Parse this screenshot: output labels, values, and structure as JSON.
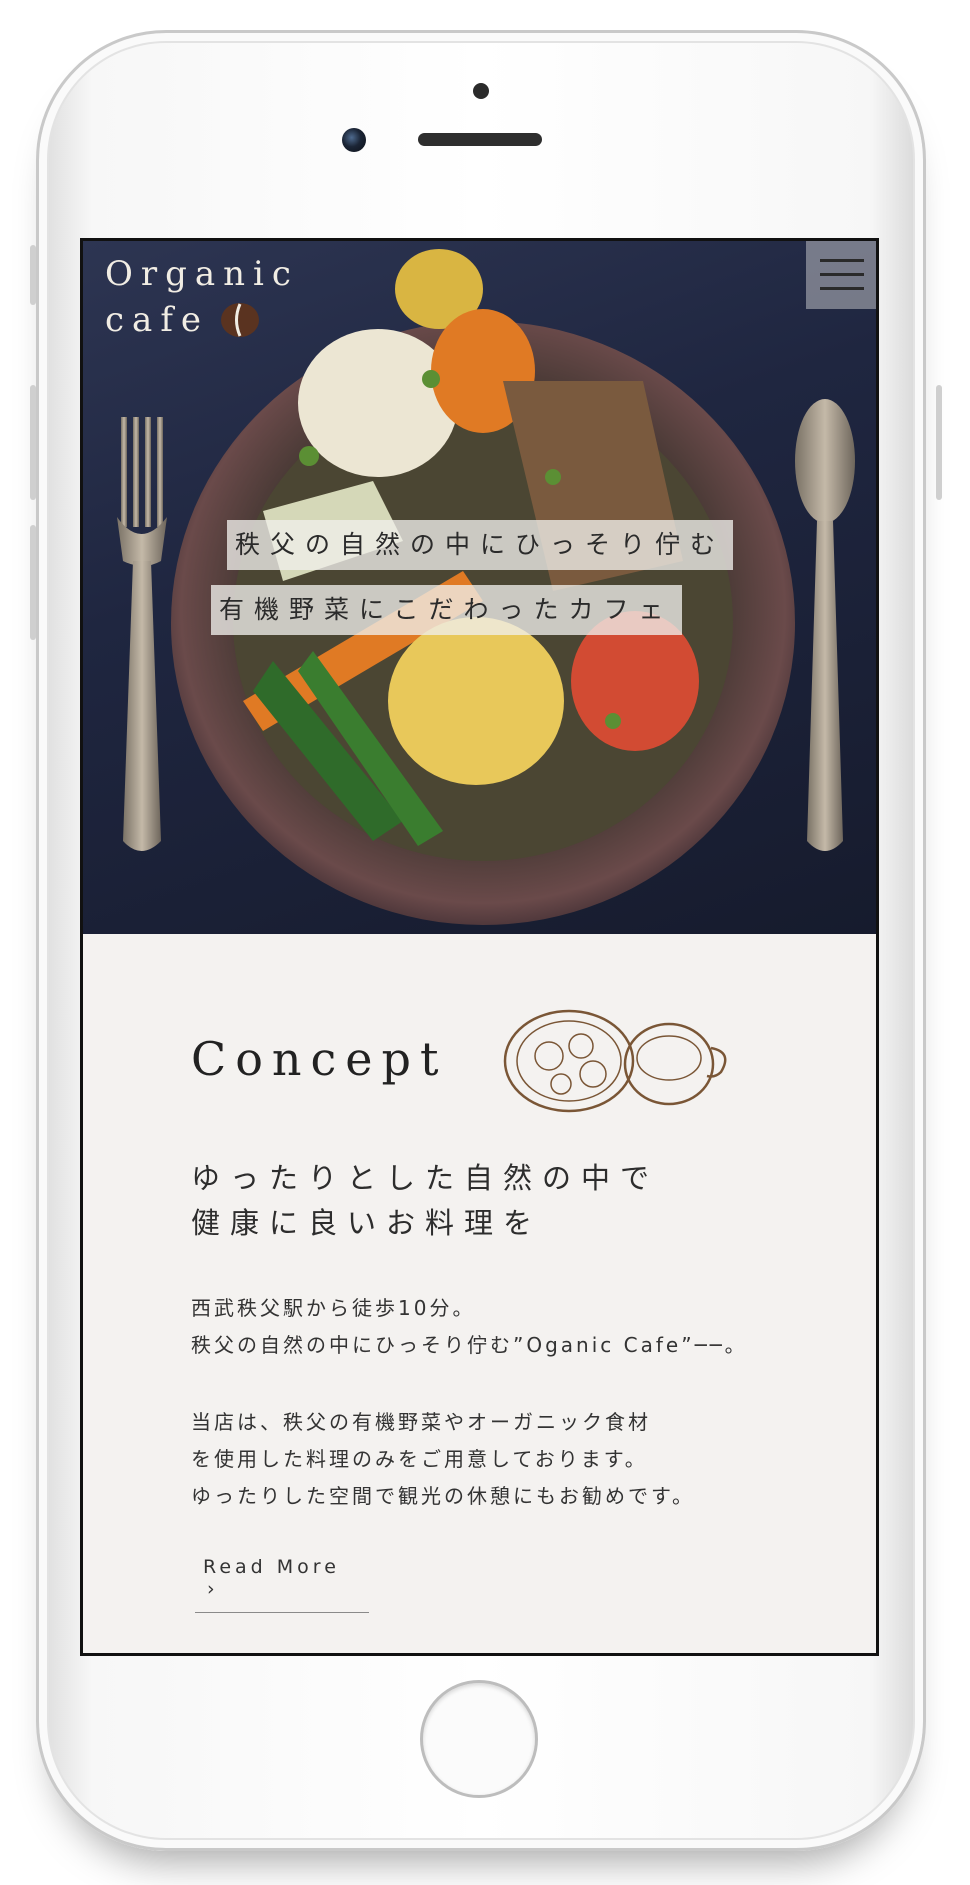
{
  "site": {
    "logo_line1": "Organic",
    "logo_line2": "cafe",
    "menu_icon": "hamburger-icon"
  },
  "hero": {
    "tagline_1": "秩父の自然の中にひっそり佇む",
    "tagline_2": "有機野菜にこだわったカフェ"
  },
  "concept": {
    "title": "Concept",
    "headline_1": "ゆったりとした自然の中で",
    "headline_2": "健康に良いお料理を",
    "para1_line1": "西武秩父駅から徒歩10分。",
    "para1_line2": "秩父の自然の中にひっそり佇む”Oganic Cafe”──。",
    "para2_line1": "当店は、秩父の有機野菜やオーガニック食材",
    "para2_line2": "を使用した料理のみをご用意しております。",
    "para2_line3": "ゆったりした空間で観光の休憩にもお勧めです。",
    "read_more": "Read More",
    "read_more_icon": "chevron-right-icon"
  },
  "colors": {
    "background": "#f4f2f0",
    "hero_dark": "#1f2640",
    "bean": "#5a3320",
    "text": "#2d2d2d"
  }
}
